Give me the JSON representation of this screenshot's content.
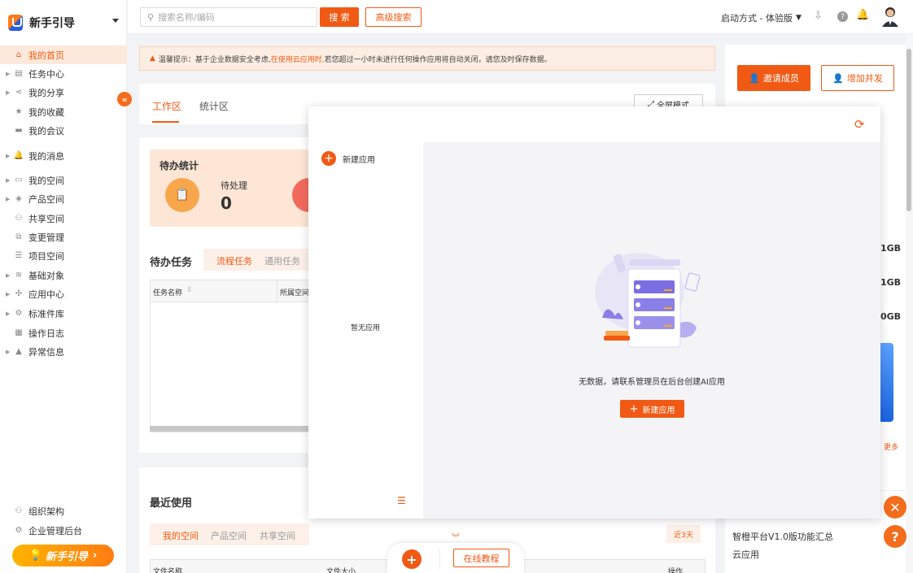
{
  "app": {
    "title": "新手引导"
  },
  "sidebar": {
    "items": [
      {
        "label": "我的首页",
        "icon": "home-icon",
        "glyph": "⌂",
        "active": true,
        "arrow": false
      },
      {
        "label": "任务中心",
        "icon": "task-icon",
        "glyph": "▤",
        "arrow": true
      },
      {
        "label": "我的分享",
        "icon": "share-icon",
        "glyph": "⋖",
        "arrow": true
      },
      {
        "label": "我的收藏",
        "icon": "star-icon",
        "glyph": "★",
        "arrow": false
      },
      {
        "label": "我的会议",
        "icon": "video-icon",
        "glyph": "▬",
        "arrow": false
      },
      {
        "label": "我的消息",
        "icon": "bell-icon",
        "glyph": "🔔",
        "arrow": true
      },
      {
        "label": "我的空间",
        "icon": "drive-icon",
        "glyph": "▭",
        "arrow": true
      },
      {
        "label": "产品空间",
        "icon": "cube-icon",
        "glyph": "◈",
        "arrow": true
      },
      {
        "label": "共享空间",
        "icon": "people-icon",
        "glyph": "⚇",
        "arrow": false
      },
      {
        "label": "变更管理",
        "icon": "change-icon",
        "glyph": "⧉",
        "arrow": false
      },
      {
        "label": "项目空间",
        "icon": "database-icon",
        "glyph": "☰",
        "arrow": false
      },
      {
        "label": "基础对象",
        "icon": "layers-icon",
        "glyph": "≋",
        "arrow": true
      },
      {
        "label": "应用中心",
        "icon": "apps-icon",
        "glyph": "✣",
        "arrow": true
      },
      {
        "label": "标准件库",
        "icon": "gear-icon",
        "glyph": "⚙",
        "arrow": true
      },
      {
        "label": "操作日志",
        "icon": "log-icon",
        "glyph": "▦",
        "arrow": false
      },
      {
        "label": "异常信息",
        "icon": "warning-icon",
        "glyph": "▲",
        "arrow": true
      }
    ],
    "bottom": [
      {
        "label": "组织架构",
        "icon": "org-icon",
        "glyph": "⚇"
      },
      {
        "label": "企业管理后台",
        "icon": "settings-icon",
        "glyph": "⚙"
      }
    ],
    "guide_button": "新手引导"
  },
  "topbar": {
    "search_placeholder": "搜索名称/编码",
    "search_button": "搜 索",
    "advanced_search": "高级搜索",
    "launch_mode": "启动方式 - 体验版"
  },
  "notice": {
    "prefix": "温馨提示：基于企业数据安全考虑,",
    "highlight": "在使用云应用时,",
    "suffix": "若您超过一小时未进行任何操作应用将自动关闭，请您及时保存数据。"
  },
  "workspace": {
    "tabs": [
      "工作区",
      "统计区"
    ],
    "fullscreen": "全屏模式",
    "pending_stats": {
      "title": "待办统计",
      "label": "待处理",
      "count": "0"
    },
    "todo": {
      "title": "待办任务",
      "tabs": [
        "流程任务",
        "通用任务"
      ],
      "columns": [
        "任务名称",
        "所属空间"
      ]
    },
    "recent": {
      "title": "最近使用",
      "tabs": [
        "我的空间",
        "产品空间",
        "共享空间"
      ],
      "range": "近3天",
      "columns": [
        "文件名称",
        "文件大小",
        "",
        ""
      ],
      "action": "操作"
    }
  },
  "overlay": {
    "new_app": "新建应用",
    "no_app": "暂无应用",
    "empty_text": "无数据，请联系管理员在后台创建AI应用",
    "create_button": "新建应用"
  },
  "right_panel": {
    "invite": "邀请成员",
    "add_concurrency": "增加并发",
    "storage": [
      "1GB",
      "1GB",
      "0GB"
    ],
    "more": "更多",
    "news": [
      "智橙平台V1.0版功能汇总",
      "云应用"
    ]
  },
  "bottom_bar": {
    "tutorial": "在线教程"
  },
  "colors": {
    "accent": "#f05a14",
    "accent_light": "#fde9dc"
  }
}
